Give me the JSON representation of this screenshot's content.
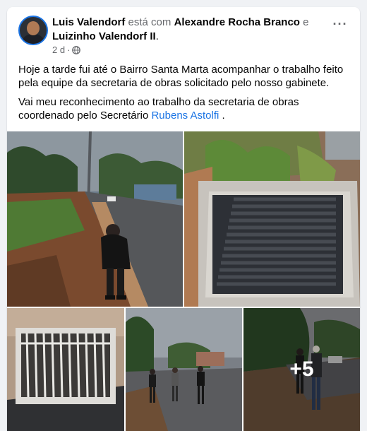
{
  "post": {
    "author": "Luis Valendorf",
    "with_word": "está com",
    "tagged_1": "Alexandre Rocha Branco",
    "and_word": "e",
    "tagged_2": "Luizinho Valendorf II",
    "period": ".",
    "time": "2 d",
    "dot": "·",
    "privacy_icon": "globe-icon",
    "more_icon": "more-options-icon",
    "more_label": "···",
    "paragraph_1": "Hoje a tarde fui até o Bairro Santa Marta acompanhar o trabalho feito pela equipe da secretaria de obras solicitado pelo nosso gabinete.",
    "paragraph_2_line_1": "Vai meu reconhecimento ao trabalho da secretaria de obras",
    "paragraph_2_line_2_prefix": "coordenado pelo Secretário",
    "paragraph_2_link": "Rubens Astolfi",
    "paragraph_2_suffix": " ."
  },
  "gallery": {
    "extra_count": "+5"
  },
  "colors": {
    "link": "#1b74e4",
    "background": "#f0f2f5"
  }
}
